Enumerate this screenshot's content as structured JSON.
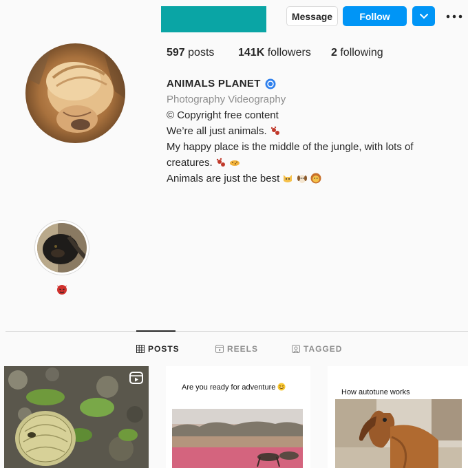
{
  "header": {
    "message_label": "Message",
    "follow_label": "Follow",
    "username_block_color": "#0aa5a5"
  },
  "stats": {
    "posts_count": "597",
    "posts_label": " posts",
    "followers_count": "141K",
    "followers_label": " followers",
    "following_count": "2",
    "following_label": " following"
  },
  "bio": {
    "name": "ANIMALS PLANET",
    "category": "Photography Videography",
    "line1": "© Copyright free content",
    "line2": "We’re all just animals.",
    "line3": "My happy place is the middle of the jungle, with lots of creatures.",
    "line4": "Animals are just the best"
  },
  "tabs": [
    {
      "label": "POSTS",
      "icon": "grid-icon",
      "active": true
    },
    {
      "label": "REELS",
      "icon": "reels-icon",
      "active": false
    },
    {
      "label": "TAGGED",
      "icon": "tagged-icon",
      "active": false
    }
  ],
  "posts": [
    {
      "caption": "",
      "icon": "reel-badge-icon"
    },
    {
      "caption": "Are you ready for adventure"
    },
    {
      "caption": "How autotune works"
    }
  ],
  "colors": {
    "accent": "#0095f6",
    "background": "#fafafa",
    "text": "#262626",
    "muted": "#8e8e8e"
  }
}
